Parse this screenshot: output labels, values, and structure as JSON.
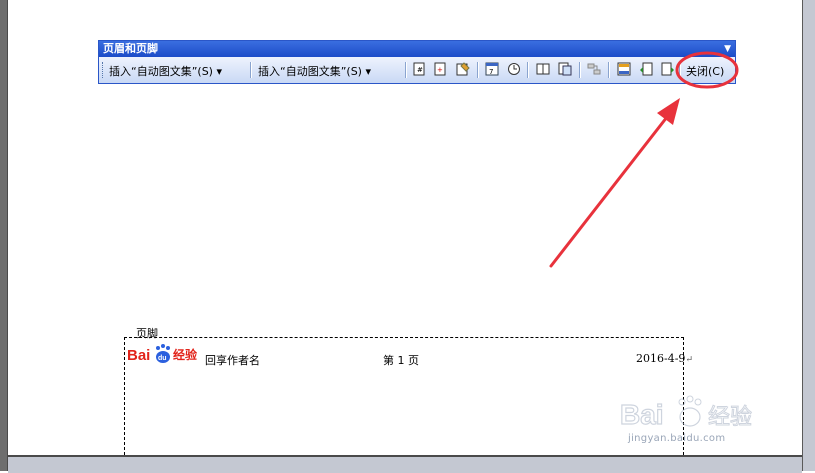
{
  "toolbar": {
    "title": "页眉和页脚",
    "insert_autotext_1": "插入“自动图文集”",
    "insert_autotext_1_accel": "(S)",
    "insert_autotext_2": "插入“自动图文集”",
    "insert_autotext_2_accel": "(S)",
    "close_label": "关闭(C)",
    "buttons": [
      "insert-page-number-icon",
      "insert-page-count-icon",
      "format-page-number-icon",
      "insert-date-icon",
      "insert-time-icon",
      "page-setup-icon",
      "show-hide-document-text-icon",
      "same-as-previous-icon",
      "switch-header-footer-icon",
      "show-previous-icon",
      "show-next-icon"
    ]
  },
  "footer": {
    "label": "页脚",
    "logo_text": "Bai du 经验",
    "author": "回享作者名",
    "page_number": "第 1 页",
    "date": "2016-4-9"
  },
  "watermark": {
    "logo_text": "Baidu 经验",
    "url": "jingyan.baidu.com"
  },
  "colors": {
    "toolbar_title_bg": "#2a5ad0",
    "toolbar_body_bg": "#d8e4f8",
    "annotation_red": "#e8323c",
    "baidu_red": "#e2231a",
    "baidu_blue": "#2b60de"
  }
}
